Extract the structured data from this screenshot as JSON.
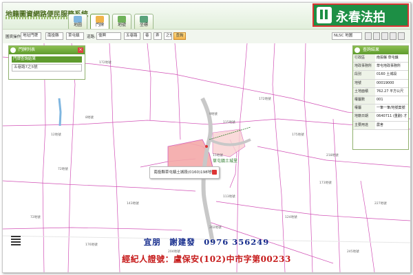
{
  "header": {
    "system_title": "地籍圖資網路便民服務系統",
    "tabs": [
      {
        "label": "地圖"
      },
      {
        "label": "門牌"
      },
      {
        "label": "地號"
      },
      {
        "label": "坐標"
      }
    ],
    "brand_name": "永春法拍"
  },
  "toolbar": {
    "search_label": "圖資操作",
    "search_type": "地址門牌",
    "county": "南投縣",
    "town": "草屯鎮",
    "road_label": "道路:",
    "road": "復興",
    "section": "五巷路",
    "lane": "巷",
    "alley": "弄",
    "number": "之5號",
    "go_label": "查詢",
    "basemap": "NLSC 地圖"
  },
  "left_panel": {
    "title": "門牌列表",
    "items": [
      "門牌查詢結果",
      "五巷路7之5號"
    ]
  },
  "right_panel": {
    "title": "查詢結果",
    "rows": [
      {
        "k": "行政區",
        "v": "南投縣 草屯鎮"
      },
      {
        "k": "地政事務所",
        "v": "草屯地政事務所"
      },
      {
        "k": "段別",
        "v": "0160 土城段"
      },
      {
        "k": "地號",
        "v": "00019000"
      },
      {
        "k": "土地面積",
        "v": "762.27 平方公尺"
      },
      {
        "k": "權屬數",
        "v": "001"
      },
      {
        "k": "權屬",
        "v": "一筆一筆/地號案號"
      },
      {
        "k": "地籍日期",
        "v": "0640711 (重劃) 才 26號"
      },
      {
        "k": "主要用途",
        "v": "農舍"
      }
    ]
  },
  "map": {
    "callout": "南投縣草屯鎮土城段(0160)198地號",
    "road_label": "草屯鎮土城里",
    "lots": [
      "172地號",
      "8地號",
      "12地號",
      "9地號",
      "172地號",
      "115地號",
      "175地號",
      "173地號",
      "72地號",
      "15地號",
      "113地號",
      "124地號",
      "143地號",
      "202地號",
      "176地號",
      "72地號",
      "218地號",
      "227地號",
      "245地號",
      "204地號"
    ]
  },
  "overlay": {
    "line1": "宜朋　謝建發　0976 356249",
    "line2": "經紀人證號：盧保安(102)中市字第00233"
  },
  "colors": {
    "brand_green": "#1d8f45",
    "header_green": "#5f9b2e",
    "parcel_line": "#d14fb5",
    "highlight": "#f4a9a9",
    "overlay_blue": "#142b8c",
    "overlay_red": "#c61a1a"
  }
}
